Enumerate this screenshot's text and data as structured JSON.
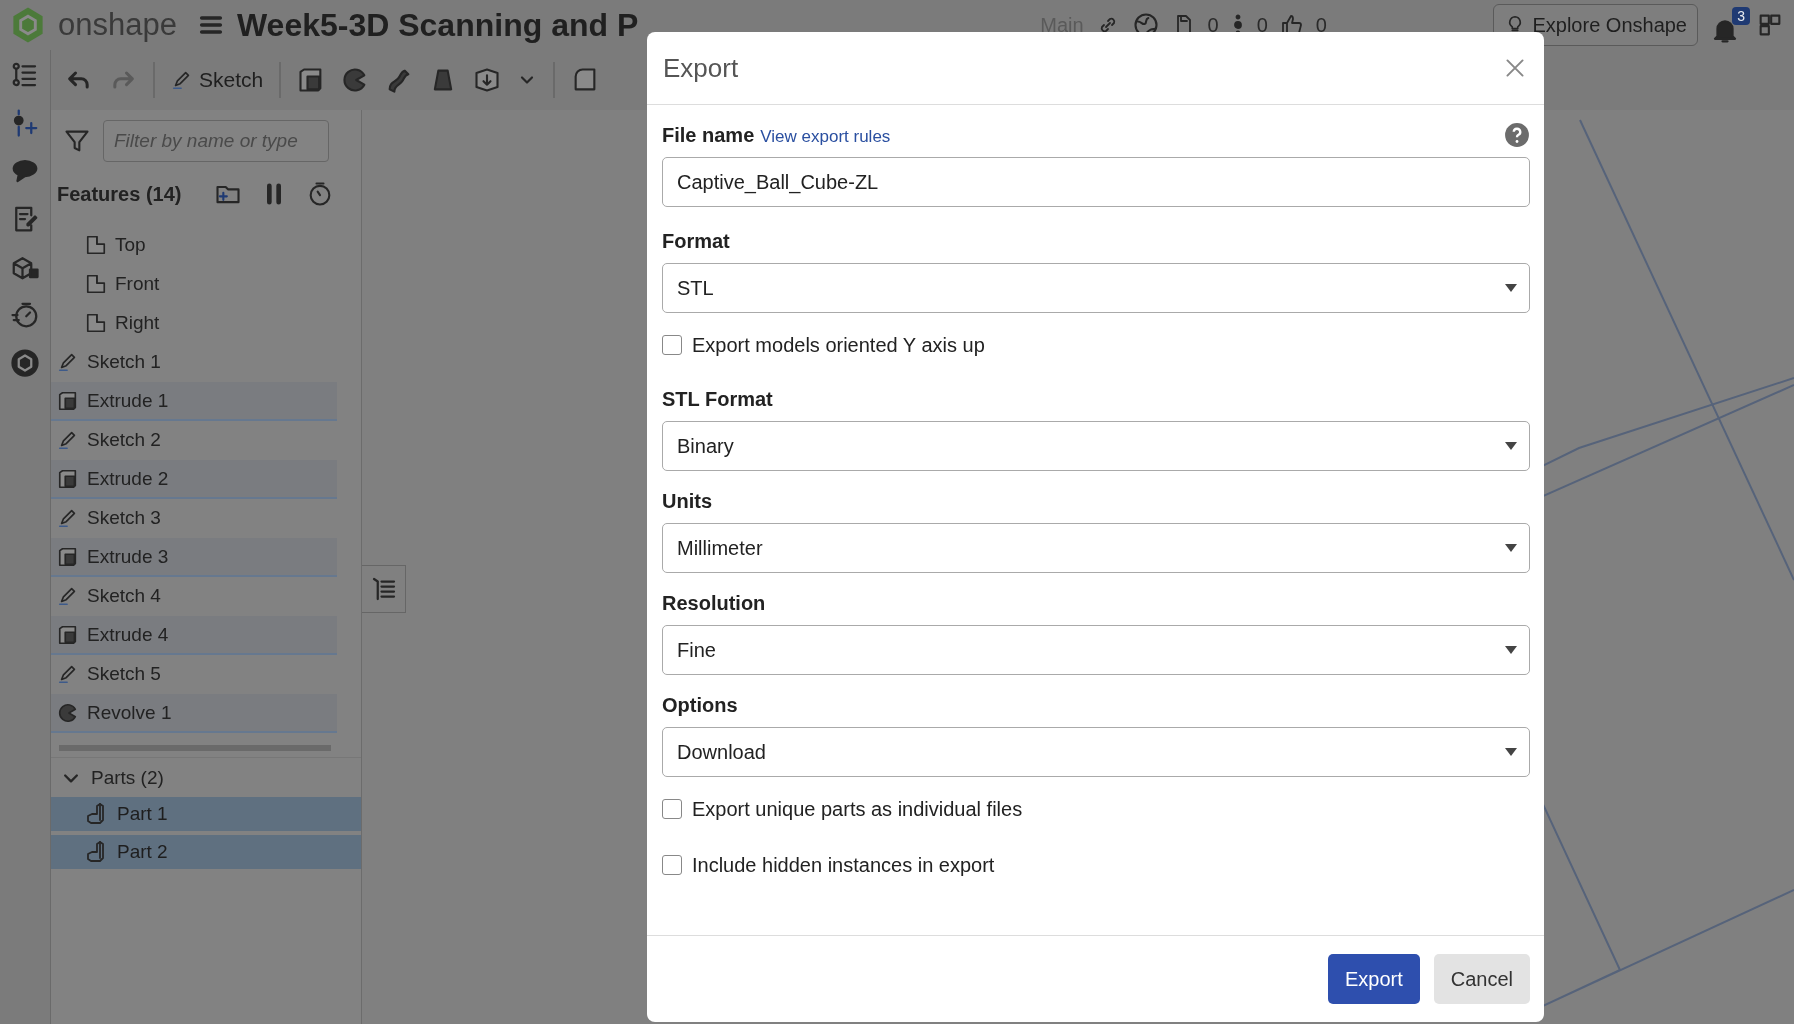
{
  "topbar": {
    "logo": "onshape",
    "doc_title": "Week5-3D Scanning and P",
    "workspace": "Main",
    "counts": [
      {
        "kind": "versions",
        "value": "0"
      },
      {
        "kind": "branches",
        "value": "0"
      },
      {
        "kind": "likes",
        "value": "0"
      }
    ],
    "explore": "Explore Onshape",
    "notifications": "3"
  },
  "toolbar": {
    "sketch": "Sketch"
  },
  "features": {
    "filter_placeholder": "Filter by name or type",
    "title": "Features (14)",
    "items": [
      {
        "kind": "plane",
        "label": "Top",
        "highlighted": false
      },
      {
        "kind": "plane",
        "label": "Front",
        "highlighted": false
      },
      {
        "kind": "plane",
        "label": "Right",
        "highlighted": false
      },
      {
        "kind": "sketch",
        "label": "Sketch 1",
        "highlighted": false
      },
      {
        "kind": "extrude",
        "label": "Extrude 1",
        "highlighted": true
      },
      {
        "kind": "sketch",
        "label": "Sketch 2",
        "highlighted": false
      },
      {
        "kind": "extrude",
        "label": "Extrude 2",
        "highlighted": true
      },
      {
        "kind": "sketch",
        "label": "Sketch 3",
        "highlighted": false
      },
      {
        "kind": "extrude",
        "label": "Extrude 3",
        "highlighted": true
      },
      {
        "kind": "sketch",
        "label": "Sketch 4",
        "highlighted": false
      },
      {
        "kind": "extrude",
        "label": "Extrude 4",
        "highlighted": true
      },
      {
        "kind": "sketch",
        "label": "Sketch 5",
        "highlighted": false
      },
      {
        "kind": "revolve",
        "label": "Revolve 1",
        "highlighted": true
      }
    ]
  },
  "parts": {
    "title": "Parts (2)",
    "expanded": true,
    "items": [
      {
        "label": "Part 1",
        "selected": true
      },
      {
        "label": "Part 2",
        "selected": true
      }
    ]
  },
  "dialog": {
    "title": "Export",
    "file_label": "File name",
    "rules_link": "View export rules",
    "file_value": "Captive_Ball_Cube-ZL",
    "fields": [
      {
        "kind": "select",
        "label": "Format",
        "value": "STL"
      },
      {
        "kind": "checkbox",
        "label": "Export models oriented Y axis up",
        "checked": false
      },
      {
        "kind": "select",
        "label": "STL Format",
        "value": "Binary"
      },
      {
        "kind": "select",
        "label": "Units",
        "value": "Millimeter"
      },
      {
        "kind": "select",
        "label": "Resolution",
        "value": "Fine"
      },
      {
        "kind": "select",
        "label": "Options",
        "value": "Download"
      },
      {
        "kind": "checkbox",
        "label": "Export unique parts as individual files",
        "checked": false
      },
      {
        "kind": "checkbox",
        "label": "Include hidden instances in export",
        "checked": false
      }
    ],
    "buttons": [
      {
        "kind": "primary",
        "label": "Export"
      },
      {
        "kind": "secondary",
        "label": "Cancel"
      }
    ]
  }
}
